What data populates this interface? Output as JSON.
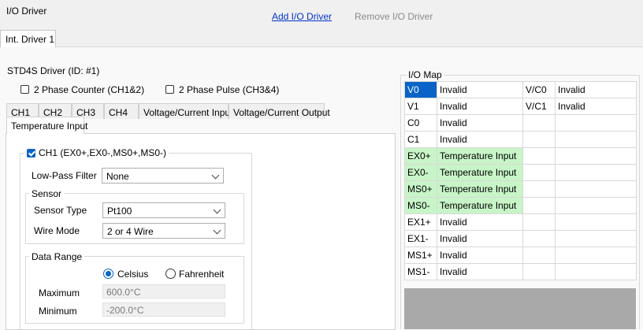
{
  "header": {
    "title": "I/O Driver",
    "add_label": "Add I/O Driver",
    "remove_label": "Remove I/O Driver"
  },
  "outer_tab": {
    "label": "Int. Driver 1"
  },
  "driver": {
    "title": "STD4S Driver (ID: #1)",
    "phase_counter": {
      "label": "2 Phase Counter (CH1&2)",
      "checked": false
    },
    "phase_pulse": {
      "label": "2 Phase Pulse (CH3&4)",
      "checked": false
    }
  },
  "inner_tabs": [
    "CH1",
    "CH2",
    "CH3",
    "CH4",
    "Voltage/Current Input",
    "Voltage/Current Output",
    "Temperature Input"
  ],
  "ch1": {
    "label": "CH1 (EX0+,EX0-,MS0+,MS0-)",
    "checked": true,
    "lowpass": {
      "label": "Low-Pass Filter",
      "value": "None"
    },
    "sensor": {
      "title": "Sensor",
      "type_label": "Sensor Type",
      "type_value": "Pt100",
      "wire_label": "Wire Mode",
      "wire_value": "2 or 4 Wire"
    },
    "range": {
      "title": "Data Range",
      "celsius": "Celsius",
      "fahrenheit": "Fahrenheit",
      "unit_selected": "Celsius",
      "max_label": "Maximum",
      "max_value": "600.0°C",
      "min_label": "Minimum",
      "min_value": "-200.0°C"
    }
  },
  "io_map": {
    "title": "I/O Map",
    "rows": [
      {
        "pin": "V0",
        "value": "Invalid",
        "pin2": "V/C0",
        "value2": "Invalid",
        "selected": true,
        "highlight": false
      },
      {
        "pin": "V1",
        "value": "Invalid",
        "pin2": "V/C1",
        "value2": "Invalid",
        "selected": false,
        "highlight": false
      },
      {
        "pin": "C0",
        "value": "Invalid",
        "pin2": "",
        "value2": "",
        "selected": false,
        "highlight": false
      },
      {
        "pin": "C1",
        "value": "Invalid",
        "pin2": "",
        "value2": "",
        "selected": false,
        "highlight": false
      },
      {
        "pin": "EX0+",
        "value": "Temperature Input",
        "pin2": "",
        "value2": "",
        "selected": false,
        "highlight": true
      },
      {
        "pin": "EX0-",
        "value": "Temperature Input",
        "pin2": "",
        "value2": "",
        "selected": false,
        "highlight": true
      },
      {
        "pin": "MS0+",
        "value": "Temperature Input",
        "pin2": "",
        "value2": "",
        "selected": false,
        "highlight": true
      },
      {
        "pin": "MS0-",
        "value": "Temperature Input",
        "pin2": "",
        "value2": "",
        "selected": false,
        "highlight": true
      },
      {
        "pin": "EX1+",
        "value": "Invalid",
        "pin2": "",
        "value2": "",
        "selected": false,
        "highlight": false
      },
      {
        "pin": "EX1-",
        "value": "Invalid",
        "pin2": "",
        "value2": "",
        "selected": false,
        "highlight": false
      },
      {
        "pin": "MS1+",
        "value": "Invalid",
        "pin2": "",
        "value2": "",
        "selected": false,
        "highlight": false
      },
      {
        "pin": "MS1-",
        "value": "Invalid",
        "pin2": "",
        "value2": "",
        "selected": false,
        "highlight": false
      }
    ]
  },
  "colors": {
    "accent": "#0a64c8",
    "highlight_green": "#c8f5c8",
    "link": "#0033cc"
  }
}
